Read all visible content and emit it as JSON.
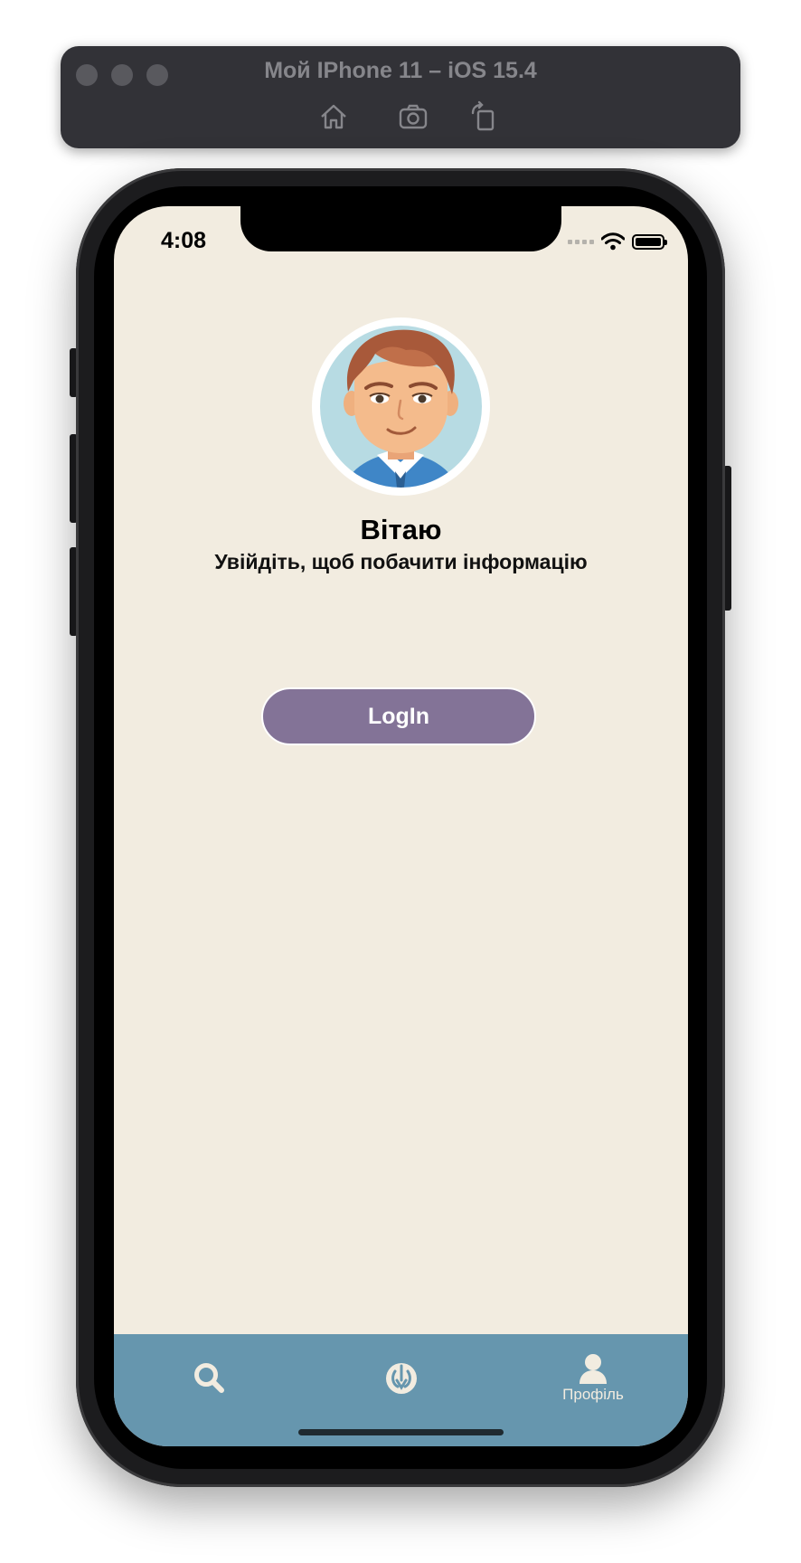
{
  "window": {
    "title": "Мой IPhone 11 – iOS 15.4",
    "toolbar": [
      "home-icon",
      "screenshot-icon",
      "rotate-icon"
    ]
  },
  "status_bar": {
    "time": "4:08"
  },
  "profile": {
    "greeting": "Вітаю",
    "subtitle": "Увійдіть, щоб побачити інформацію",
    "login_label": "LogIn"
  },
  "tab_bar": {
    "items": [
      {
        "icon": "search-icon",
        "label": ""
      },
      {
        "icon": "rebel-alliance-icon",
        "label": ""
      },
      {
        "icon": "person-icon",
        "label": "Профіль"
      }
    ]
  },
  "colors": {
    "background": "#f2ece0",
    "tab_bar": "#6696ae",
    "login_button": "#837397"
  }
}
